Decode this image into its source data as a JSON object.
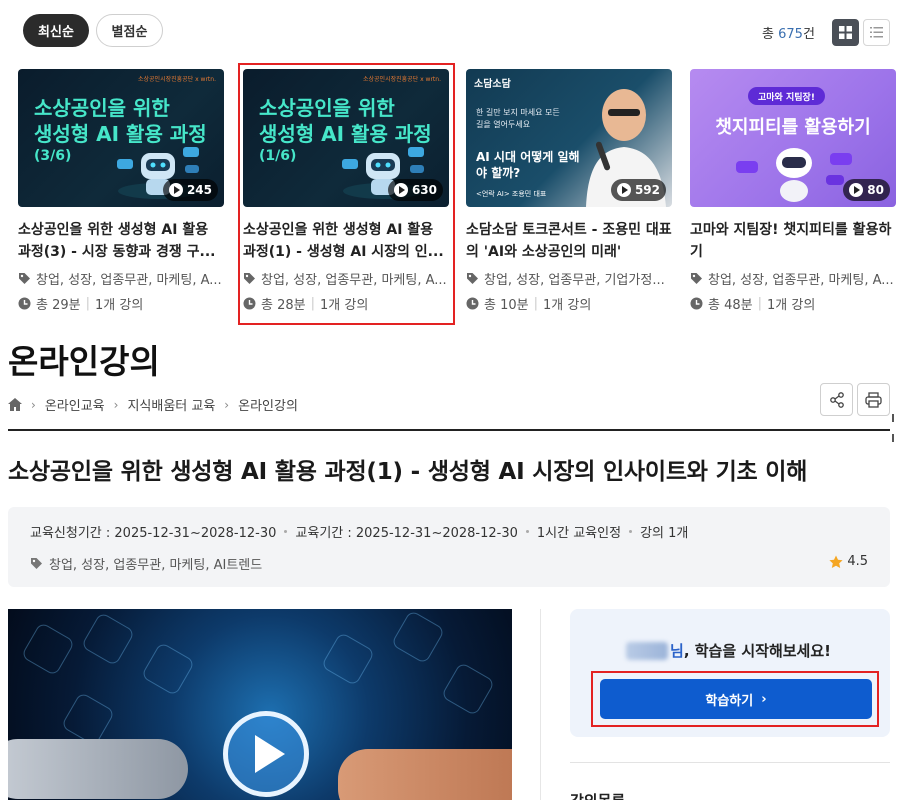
{
  "sort": {
    "latest": "최신순",
    "rating": "별점순"
  },
  "total": {
    "prefix": "총",
    "count": "675",
    "suffix": "건"
  },
  "cards": [
    {
      "thumb_title_line1": "소상공인을 위한",
      "thumb_title_line2": "생성형 AI 활용 과정",
      "thumb_part": "(3/6)",
      "thumb_brand": "소상공인시장진흥공단 x wrtn.",
      "plays": "245",
      "title": "소상공인을 위한 생성형 AI 활용 과정(3) - 시장 동향과 경쟁 구...",
      "tags": "창업, 성장, 업종무관, 마케팅, A...",
      "duration": "총 29분",
      "lectures": "1개 강의"
    },
    {
      "thumb_title_line1": "소상공인을 위한",
      "thumb_title_line2": "생성형 AI 활용 과정",
      "thumb_part": "(1/6)",
      "thumb_brand": "소상공인시장진흥공단 x wrtn.",
      "plays": "630",
      "title": "소상공인을 위한 생성형 AI 활용 과정(1) - 생성형 AI 시장의 인...",
      "tags": "창업, 성장, 업종무관, 마케팅, A...",
      "duration": "총 28분",
      "lectures": "1개 강의"
    },
    {
      "thumb_logo": "소담소담",
      "thumb_quote": "한 길만 보지 마세요 모든 길을 열어두세요",
      "thumb_head": "AI 시대 어떻게 일해야 할까?",
      "thumb_caption": "<언락 AI> 조용민 대표",
      "plays": "592",
      "title": "소담소담 토크콘서트 - 조용민 대표의 'AI와 소상공인의 미래'",
      "tags": "창업, 성장, 업종무관, 기업가정...",
      "duration": "총 10분",
      "lectures": "1개 강의"
    },
    {
      "thumb_pill": "고마와 지팀장!",
      "thumb_head": "챗지피티를 활용하기",
      "plays": "80",
      "title": "고마와 지팀장! 챗지피티를 활용하기",
      "tags": "창업, 성장, 업종무관, 마케팅, A...",
      "duration": "총 48분",
      "lectures": "1개 강의"
    }
  ],
  "page_title": "온라인강의",
  "breadcrumb": [
    "온라인교육",
    "지식배움터 교육",
    "온라인강의"
  ],
  "course": {
    "title": "소상공인을 위한 생성형 AI 활용 과정(1) - 생성형 AI 시장의 인사이트와 기초 이해",
    "apply_period": "교육신청기간 : 2025-12-31~2028-12-30",
    "edu_period": "교육기간 : 2025-12-31~2028-12-30",
    "credit": "1시간 교육인정",
    "lecture_count": "강의 1개",
    "tags": "창업, 성장, 업종무관, 마케팅, AI트렌드",
    "rating": "4.5"
  },
  "panel": {
    "greeting_suffix": "님",
    "greeting_rest": ", 학습을 시작해보세요!",
    "study_button": "학습하기",
    "lecture_list": "강의목록"
  },
  "icons": {
    "home": "home-icon",
    "share": "share-icon",
    "print": "print-icon",
    "tag": "tag-icon",
    "clock": "clock-icon",
    "star": "star-icon"
  },
  "colors": {
    "accent_blue": "#0e5ccf",
    "highlight_red": "#e32222",
    "teal_text": "#46e6c9",
    "star": "#f5a623"
  }
}
